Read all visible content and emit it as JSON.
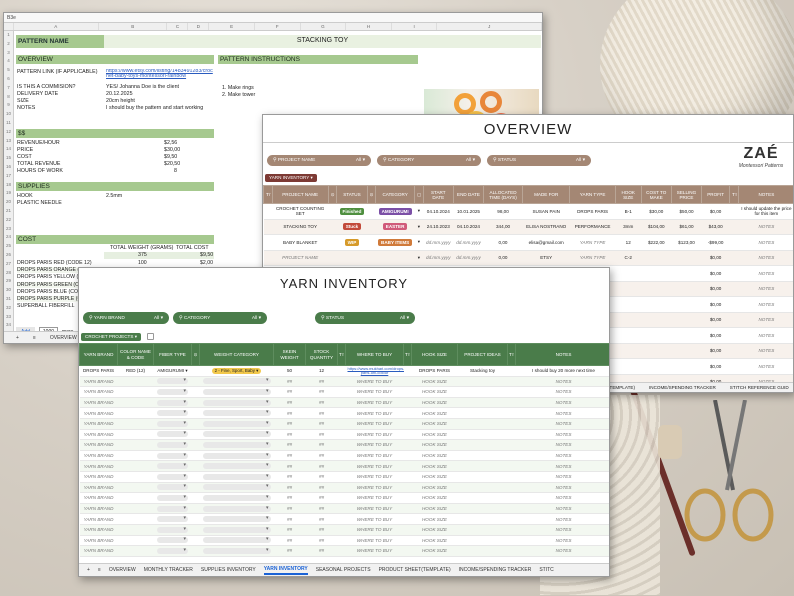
{
  "colors": {
    "pattern_green": "#a6c98f",
    "overview_brown": "#a48774",
    "yarn_green": "#4a7c4a",
    "finished": "#4f8f3f",
    "stuck": "#c24a3a",
    "wip": "#d69a2a",
    "amigurumi": "#7b4fa6",
    "easter": "#d05a7a",
    "baby_items": "#d07a3a",
    "weight_chip": "#f2c84b"
  },
  "pattern_sheet": {
    "cell_ref": "B3e",
    "columns": [
      "A",
      "B",
      "C",
      "D",
      "E",
      "F",
      "G",
      "H",
      "I",
      "J"
    ],
    "row_numbers": [
      "1",
      "2",
      "3",
      "4",
      "5",
      "6",
      "7",
      "8",
      "9",
      "10",
      "11",
      "12",
      "13",
      "14",
      "15",
      "16",
      "17",
      "18",
      "19",
      "20",
      "21",
      "22",
      "23",
      "24",
      "25",
      "26",
      "27",
      "28",
      "29",
      "30",
      "31",
      "32",
      "33",
      "34"
    ],
    "pattern_name_label": "PATTERN NAME",
    "pattern_name_value": "STACKING TOY",
    "overview_label": "OVERVIEW",
    "instructions_label": "PATTERN INSTRUCTIONS",
    "fields": [
      {
        "label": "PATTERN LINK (IF APPLICABLE)",
        "value": "https://www.etsy.com/listing/1483491283/crochet-baby-toys-montessori-rainbow"
      },
      {
        "label": "IS THIS A COMMISION?",
        "value": "YES/ Johanna Doe is the client"
      },
      {
        "label": "DELIVERY DATE",
        "value": "20.12.2025"
      },
      {
        "label": "SIZE",
        "value": "20cm height"
      },
      {
        "label": "NOTES",
        "value": "I should buy the pattern and start working"
      }
    ],
    "instructions": [
      "1. Make rings",
      "2. Make tower"
    ],
    "money_label": "$$",
    "money": [
      {
        "label": "REVENUE/HOUR",
        "value": "$2,56"
      },
      {
        "label": "PRICE",
        "value": "$30,00"
      },
      {
        "label": "COST",
        "value": "$9,50"
      },
      {
        "label": "TOTAL REVENUE",
        "value": "$20,50"
      },
      {
        "label": "HOURS OF WORK",
        "value": "8"
      }
    ],
    "supplies_label": "SUPPLIES",
    "supplies": [
      {
        "label": "HOOK",
        "value": "2.5mm"
      },
      {
        "label": "PLASTIC NEEDLE",
        "value": ""
      }
    ],
    "cost_label": "COST",
    "cost_headers": [
      "TOTAL WEIGHT (GRAMS)",
      "TOTAL COST"
    ],
    "cost_subrow": [
      "375",
      "$9,50"
    ],
    "cost_rows": [
      {
        "label": "DROPS PARIS RED (CODE 12)",
        "weight": "100",
        "cost": "$2,00"
      },
      {
        "label": "DROPS PARIS ORANGE (CO",
        "weight": "",
        "cost": ""
      },
      {
        "label": "DROPS PARIS YELLOW (C",
        "weight": "",
        "cost": ""
      },
      {
        "label": "DROPS PARIS GREEN (CO",
        "weight": "",
        "cost": ""
      },
      {
        "label": "DROPS PARIS BLUE (CO",
        "weight": "",
        "cost": ""
      },
      {
        "label": "DROPS PARIS PURPLE (C",
        "weight": "",
        "cost": ""
      },
      {
        "label": "SUPERBALL FIBERFILL",
        "weight": "",
        "cost": ""
      }
    ],
    "add_button": "Add",
    "add_count": "1000",
    "add_more": "more",
    "tab_overview": "OVERVIEW"
  },
  "overview_sheet": {
    "title": "OVERVIEW",
    "filters": [
      {
        "label": "PROJECT NAME",
        "value": "All"
      },
      {
        "label": "CATEGORY",
        "value": "All"
      },
      {
        "label": "STATUS",
        "value": "All"
      }
    ],
    "logo_main": "ZAÉ",
    "logo_sub": "Montessori Patterns",
    "view_label": "YARN INVENTORY",
    "headers": [
      "Tт",
      "PROJECT NAME",
      "⊙",
      "STATUS",
      "⊙",
      "CATEGORY",
      "▢",
      "START DATE",
      "END DATE",
      "ALLOCATED TIME (DAYS)",
      "MADE FOR",
      "YARN TYPE",
      "HOOK SIZE",
      "COST TO MAKE",
      "SELLING PRICE",
      "PROFIT",
      "Tт",
      "NOTES"
    ],
    "rows": [
      {
        "name": "CROCHET COUNTING SET",
        "status": "Finished",
        "status_color": "#4f8f3f",
        "category": "AMIGURUMI",
        "cat_color": "#7b4fa6",
        "start": "04.10.2024",
        "end": "10.01.2025",
        "days": "98,00",
        "made_for": "SUSAN PAIN",
        "yarn": "DROPS PARIS",
        "hook": "B-1",
        "cost": "$30,00",
        "price": "$50,00",
        "profit": "$0,00",
        "notes": "I should update the price for this item"
      },
      {
        "name": "STACKING TOY",
        "status": "Stuck",
        "status_color": "#c24a3a",
        "category": "EASTER",
        "cat_color": "#d05a7a",
        "start": "24.10.2023",
        "end": "04.10.2024",
        "days": "344,00",
        "made_for": "ELISA NOSTRANO",
        "yarn": "PERFORMANCE",
        "hook": "3mm",
        "cost": "$104,00",
        "price": "$61,00",
        "profit": "$43,00",
        "notes": "NOTES"
      },
      {
        "name": "BABY BLANKET",
        "status": "WIP",
        "status_color": "#d69a2a",
        "category": "BABY ITEMS",
        "cat_color": "#d07a3a",
        "start": "dd.mm.yyyy",
        "end": "dd.mm.yyyy",
        "days": "0,00",
        "made_for": "elisa@gmail.com",
        "yarn": "YARN TYPE",
        "hook": "12",
        "cost": "$222,00",
        "price": "$123,00",
        "profit": "-$99,00",
        "notes": "NOTES"
      },
      {
        "name": "PROJECT NAME",
        "status": "",
        "status_color": "",
        "category": "",
        "cat_color": "",
        "start": "dd.mm.yyyy",
        "end": "dd.mm.yyyy",
        "days": "0,00",
        "made_for": "ETSY",
        "yarn": "YARN TYPE",
        "hook": "C-2",
        "cost": "",
        "price": "",
        "profit": "$0,00",
        "notes": "NOTES"
      }
    ],
    "empty_profit": "$0,00",
    "empty_notes": "NOTES",
    "tabs": [
      "(TEMPLATE)",
      "INCOME/SPENDING TRACKER",
      "STITCH REFERENCE GUID"
    ]
  },
  "yarn_sheet": {
    "title": "YARN INVENTORY",
    "filters": [
      {
        "label": "YARN BRAND",
        "value": "All"
      },
      {
        "label": "CATEGORY",
        "value": "All"
      },
      {
        "label": "STATUS",
        "value": "All"
      }
    ],
    "view_label": "CROCHET PROJECTS",
    "headers": [
      "YARN BRAND",
      "COLOR NAME & CODE",
      "FIBER TYPE",
      "⊙",
      "WEIGHT CATEGORY",
      "SKEIN WEIGHT",
      "STOCK QUANTITY",
      "Tт",
      "WHERE TO BUY",
      "Tт",
      "HOOK SIZE",
      "PROJECT IDEAS",
      "Tт",
      "NOTES"
    ],
    "first_row": {
      "brand": "DROPS PARIS",
      "color": "RED (12)",
      "fiber": "AMIGURUMI",
      "weight_cat": "2 - Fine, Sport, Baby",
      "skein": "50",
      "stock": "12",
      "where": "https://www.mukhari.com/drops-paris-uni-colour",
      "hook": "DROPS PARIS",
      "ideas": "Stacking toy",
      "notes": "I should buy 20 more next time"
    },
    "placeholder_row": {
      "brand": "YARN BRAND",
      "skein": "##",
      "stock": "##",
      "where": "WHERE TO BUY",
      "hook": "HOOK SIZE",
      "notes": "NOTES"
    },
    "tabs": [
      "OVERVIEW",
      "MONTHLY TRACKER",
      "SUPPLIES INVENTORY",
      "YARN INVENTORY",
      "SEASONAL PROJECTS",
      "PRODUCT SHEET(TEMPLATE)",
      "INCOME/SPENDING TRACKER",
      "STITC"
    ],
    "active_tab": "YARN INVENTORY"
  }
}
